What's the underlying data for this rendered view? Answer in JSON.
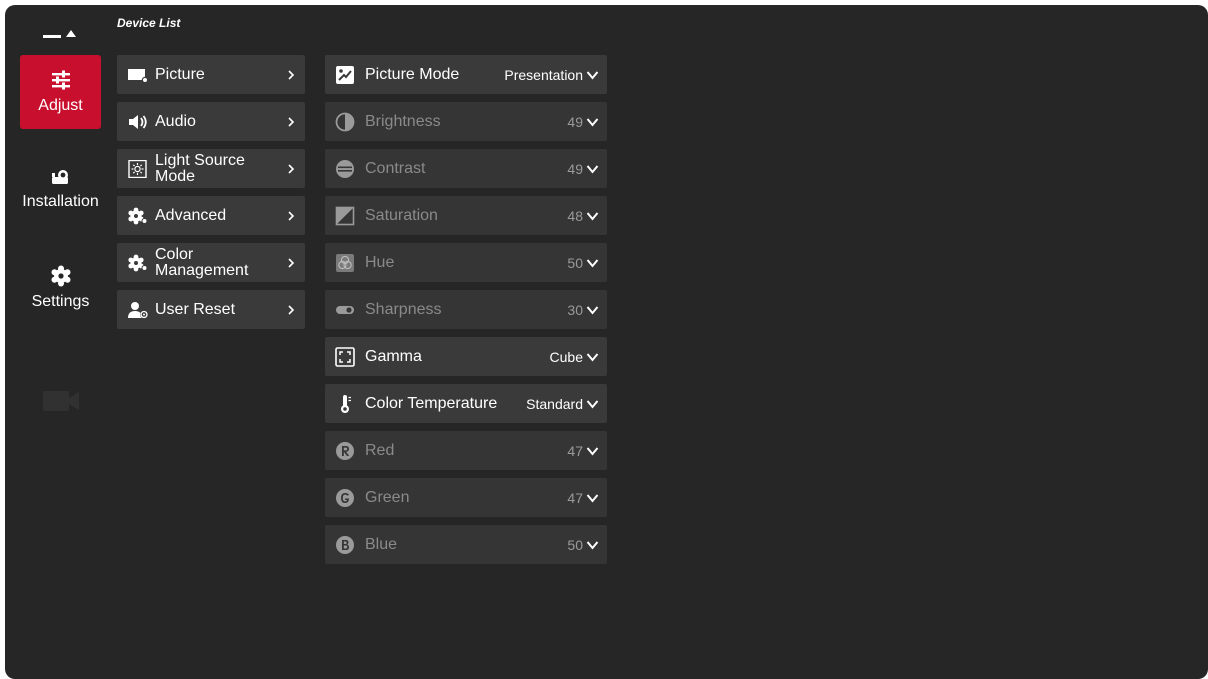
{
  "header": {
    "title": "Device List"
  },
  "nav": {
    "items": [
      {
        "label": "Adjust",
        "icon": "sliders-icon",
        "active": true
      },
      {
        "label": "Installation",
        "icon": "projector-icon",
        "active": false
      },
      {
        "label": "Settings",
        "icon": "gear-icon",
        "active": false
      }
    ]
  },
  "submenu": {
    "items": [
      {
        "label": "Picture",
        "icon": "picture-icon"
      },
      {
        "label": "Audio",
        "icon": "speaker-icon"
      },
      {
        "label": "Light Source Mode",
        "icon": "light-source-icon"
      },
      {
        "label": "Advanced",
        "icon": "advanced-gear-icon"
      },
      {
        "label": "Color Management",
        "icon": "color-management-icon"
      },
      {
        "label": "User Reset",
        "icon": "user-reset-icon"
      }
    ]
  },
  "settings": {
    "rows": [
      {
        "label": "Picture Mode",
        "value": "Presentation",
        "icon": "picture-mode-icon",
        "enabled": true
      },
      {
        "label": "Brightness",
        "value": "49",
        "icon": "brightness-icon",
        "enabled": false
      },
      {
        "label": "Contrast",
        "value": "49",
        "icon": "contrast-icon",
        "enabled": false
      },
      {
        "label": "Saturation",
        "value": "48",
        "icon": "saturation-icon",
        "enabled": false
      },
      {
        "label": "Hue",
        "value": "50",
        "icon": "hue-icon",
        "enabled": false
      },
      {
        "label": "Sharpness",
        "value": "30",
        "icon": "sharpness-icon",
        "enabled": false
      },
      {
        "label": "Gamma",
        "value": "Cube",
        "icon": "gamma-icon",
        "enabled": true
      },
      {
        "label": "Color Temperature",
        "value": "Standard",
        "icon": "thermometer-icon",
        "enabled": true
      },
      {
        "label": "Red",
        "value": "47",
        "icon": "red-r-icon",
        "enabled": false
      },
      {
        "label": "Green",
        "value": "47",
        "icon": "green-g-icon",
        "enabled": false
      },
      {
        "label": "Blue",
        "value": "50",
        "icon": "blue-b-icon",
        "enabled": false
      }
    ]
  },
  "colors": {
    "background": "#262626",
    "panel": "#3a3a3a",
    "accent": "#c8102e",
    "disabled_text": "#8a8a8a"
  }
}
